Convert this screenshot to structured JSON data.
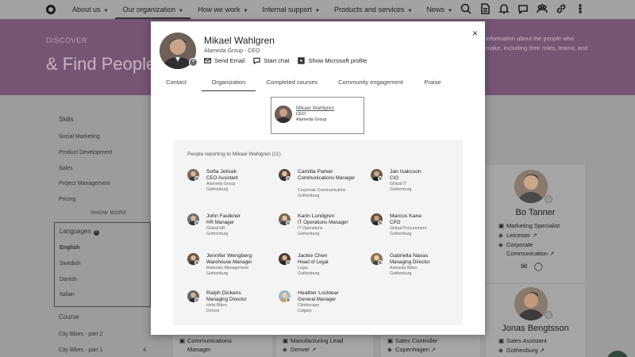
{
  "nav": {
    "items": [
      {
        "label": "Our organization",
        "active": true
      },
      {
        "label": "How we work"
      },
      {
        "label": "Internal support"
      },
      {
        "label": "Products and services"
      },
      {
        "label": "News"
      }
    ],
    "about": "About us",
    "icons": [
      "search-icon",
      "document-icon",
      "bell-icon",
      "chat-icon",
      "people-icon",
      "link-icon",
      "more-icon"
    ]
  },
  "hero": {
    "kicker": "DISCOVER",
    "title": "& Find People",
    "desc": "information about the people who make, including their roles, teams, and"
  },
  "filters": {
    "skills_head": "Skills",
    "skills": [
      "Social Marketing",
      "Product Development",
      "Sales",
      "Project Management",
      "Pricing"
    ],
    "show_more": "SHOW MORE",
    "languages_head": "Languages",
    "languages": [
      "English",
      "Swedish",
      "Danish",
      "Italian"
    ],
    "course_head": "Course",
    "courses": [
      {
        "label": "City Bikes - part 2",
        "count": ""
      },
      {
        "label": "City Bikes - part 1",
        "count": "4"
      }
    ]
  },
  "cards": {
    "bo": {
      "name": "Bo Tanner",
      "title": "Marketing Specialist",
      "city": "Leicester",
      "dept1": "Corporate",
      "dept2": "Communication"
    },
    "jonas": {
      "name": "Jonas Bengtsson",
      "title": "Sales Assistant",
      "city": "Gothenburg"
    },
    "bottom": [
      "Communications",
      "Manager",
      "Manufacturing Lead",
      "Denver",
      "Sales Controller",
      "Copenhagen"
    ]
  },
  "modal": {
    "name": "Mikael Wahlgren",
    "subtitle": "Alameda Group - CEO",
    "actions": {
      "email": "Send Email",
      "chat": "Start chat",
      "profile": "Show Microsoft profile"
    },
    "close": "×",
    "tabs": [
      "Contact",
      "Organization",
      "Completed courses",
      "Community engagement",
      "Praise"
    ],
    "org_box": {
      "name": "Mikael Wahlgren",
      "title": "CEO",
      "company": "Alameda Group"
    },
    "reports_head": "People reporting to Mikael Wahlgren (11)",
    "reports": [
      {
        "name": "Sofia Jelicek",
        "title": "CEO Assistant",
        "org": "Alameda Group",
        "city": "Gothenburg"
      },
      {
        "name": "Camilla Parker",
        "title": "Communications Manager",
        "org": "Corporate Communication",
        "city": "Gothenburg"
      },
      {
        "name": "Jan Isaksson",
        "title": "CIO",
        "org": "Global IT",
        "city": "Gothenburg"
      },
      {
        "name": "John Faulkner",
        "title": "HR Manager",
        "org": "Global HR",
        "city": "Gothenburg"
      },
      {
        "name": "Karin Lundgren",
        "title": "IT Operations Manager",
        "org": "IT Operations",
        "city": "Gothenburg"
      },
      {
        "name": "Marcus Kane",
        "title": "CPO",
        "org": "Global Procurement",
        "city": "Gothenburg"
      },
      {
        "name": "Jennifer Wengberg",
        "title": "Warehouse Manager",
        "org": "Materials Management",
        "city": "Gothenburg"
      },
      {
        "name": "Jackie Chen",
        "title": "Head of Legal",
        "org": "Legal",
        "city": "Gothenburg"
      },
      {
        "name": "Gabriella Navas",
        "title": "Managing Director",
        "org": "Alameda Bikes",
        "city": "Gothenburg"
      },
      {
        "name": "Ralph Dickens",
        "title": "Managing Director",
        "org": "Helix Bikes",
        "city": "Denver"
      },
      {
        "name": "Heather Locklear",
        "title": "General Manager",
        "org": "Climbscape",
        "city": "Calgary"
      }
    ]
  },
  "colors": {
    "hero": "#765574",
    "overlay": "#9c9c9c",
    "modal": "#ffffff"
  }
}
